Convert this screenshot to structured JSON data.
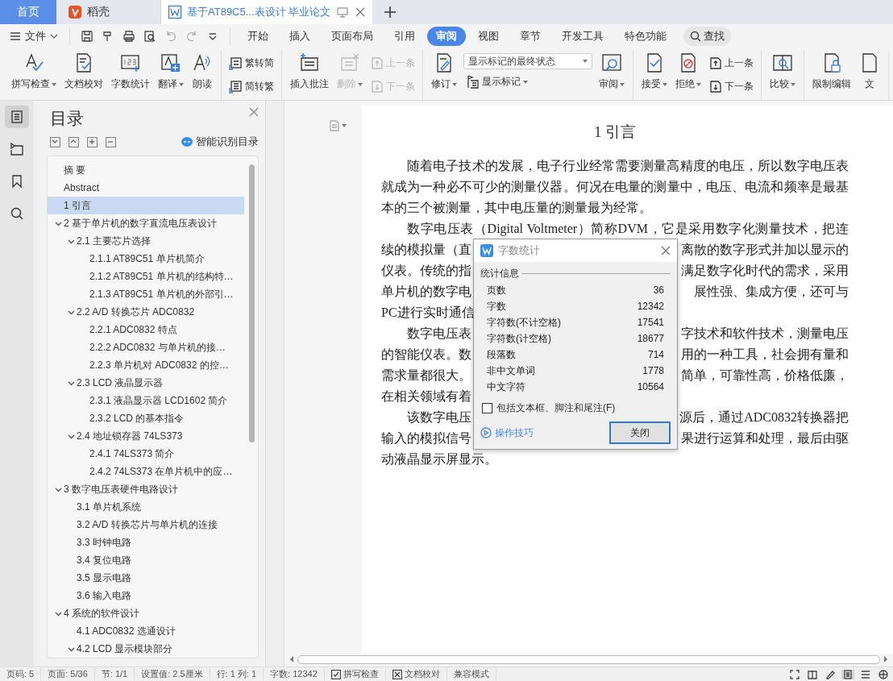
{
  "tabs": [
    {
      "label": "首页",
      "kind": "home",
      "selected": false
    },
    {
      "label": "稻壳",
      "kind": "app",
      "selected": false
    },
    {
      "label": "基于AT89C5...表设计 毕业论文",
      "kind": "doc",
      "selected": true
    }
  ],
  "menu": {
    "file": "文件",
    "tabs": [
      {
        "label": "开始",
        "selected": false
      },
      {
        "label": "插入",
        "selected": false
      },
      {
        "label": "页面布局",
        "selected": false
      },
      {
        "label": "引用",
        "selected": false
      },
      {
        "label": "审阅",
        "selected": true
      },
      {
        "label": "视图",
        "selected": false
      },
      {
        "label": "章节",
        "selected": false
      },
      {
        "label": "开发工具",
        "selected": false
      },
      {
        "label": "特色功能",
        "selected": false
      }
    ],
    "search": "查找"
  },
  "ribbon": [
    [
      {
        "kind": "large",
        "label": "拼写检查",
        "dropdown": true,
        "disabled": false
      },
      {
        "kind": "large",
        "label": "文档校对",
        "dropdown": false,
        "disabled": false
      },
      {
        "kind": "large",
        "label": "字数统计",
        "dropdown": false,
        "disabled": false
      },
      {
        "kind": "large",
        "label": "翻译",
        "dropdown": true,
        "disabled": false
      },
      {
        "kind": "large",
        "label": "朗读",
        "dropdown": false,
        "disabled": false
      }
    ],
    [
      {
        "kind": "stack",
        "items": [
          {
            "label": "繁转简",
            "dropdown": false,
            "disabled": false
          },
          {
            "label": "简转繁",
            "dropdown": false,
            "disabled": false
          }
        ]
      }
    ],
    [
      {
        "kind": "large",
        "label": "插入批注",
        "dropdown": false,
        "disabled": false
      },
      {
        "kind": "large",
        "label": "删除",
        "dropdown": true,
        "disabled": true
      },
      {
        "kind": "stack",
        "items": [
          {
            "label": "上一条",
            "dropdown": false,
            "disabled": true
          },
          {
            "label": "下一条",
            "dropdown": false,
            "disabled": true
          }
        ]
      }
    ],
    [
      {
        "kind": "large",
        "label": "修订",
        "dropdown": true,
        "disabled": false
      },
      {
        "kind": "select",
        "value": "显示标记的最终状态",
        "item": {
          "label": "显示标记",
          "dropdown": true,
          "disabled": false
        }
      },
      {
        "kind": "large",
        "label": "审阅",
        "dropdown": true,
        "disabled": false
      }
    ],
    [
      {
        "kind": "large",
        "label": "接受",
        "dropdown": true,
        "disabled": false
      },
      {
        "kind": "large",
        "label": "拒绝",
        "dropdown": true,
        "disabled": false
      },
      {
        "kind": "stack",
        "items": [
          {
            "label": "上一条",
            "dropdown": false,
            "disabled": false
          },
          {
            "label": "下一条",
            "dropdown": false,
            "disabled": false
          }
        ]
      }
    ],
    [
      {
        "kind": "large",
        "label": "比较",
        "dropdown": true,
        "disabled": false
      }
    ],
    [
      {
        "kind": "large",
        "label": "限制编辑",
        "dropdown": false,
        "disabled": false
      },
      {
        "kind": "large",
        "label": "文",
        "dropdown": false,
        "disabled": false
      }
    ]
  ],
  "sidebar": {
    "title": "目录",
    "smart": "智能识别目录",
    "toc": [
      {
        "label": "摘 要",
        "selected": false
      },
      {
        "label": "Abstract",
        "selected": false
      },
      {
        "label": "1  引言",
        "selected": true
      },
      {
        "label": "2  基于单片机的数字直流电压表设计",
        "selected": false,
        "expanded": true,
        "children": [
          {
            "label": "2.1  主要芯片选择",
            "selected": false,
            "expanded": true,
            "children": [
              {
                "label": "2.1.1 AT89C51 单片机简介",
                "selected": false
              },
              {
                "label": "2.1.2 AT89C51 单片机的结构特…",
                "selected": false
              },
              {
                "label": "2.1.3 AT89C51 单片机的外部引…",
                "selected": false
              }
            ]
          },
          {
            "label": "2.2 A/D 转换芯片 ADC0832",
            "selected": false,
            "expanded": true,
            "children": [
              {
                "label": "2.2.1 ADC0832 特点",
                "selected": false
              },
              {
                "label": "2.2.2 ADC0832  与单片机的接…",
                "selected": false
              },
              {
                "label": "2.2.3  单片机对 ADC0832  的控…",
                "selected": false
              }
            ]
          },
          {
            "label": "2.3 LCD 液晶显示器",
            "selected": false,
            "expanded": true,
            "children": [
              {
                "label": "2.3.1 液晶显示器 LCD1602 简介",
                "selected": false
              },
              {
                "label": "2.3.2 LCD 的基本指令",
                "selected": false
              }
            ]
          },
          {
            "label": "2.4  地址锁存器 74LS373",
            "selected": false,
            "expanded": true,
            "children": [
              {
                "label": "2.4.1 74LS373 简介",
                "selected": false
              },
              {
                "label": "2.4.2 74LS373 在单片机中的应…",
                "selected": false
              }
            ]
          }
        ]
      },
      {
        "label": "3 数字电压表硬件电路设计",
        "selected": false,
        "expanded": true,
        "children": [
          {
            "label": "3.1  单片机系统",
            "selected": false
          },
          {
            "label": "3.2 A/D 转换芯片与单片机的连接",
            "selected": false
          },
          {
            "label": "3.3  时钟电路",
            "selected": false
          },
          {
            "label": "3.4  复位电路",
            "selected": false
          },
          {
            "label": "3.5  显示电路",
            "selected": false
          },
          {
            "label": "3.6  输入电路",
            "selected": false
          }
        ]
      },
      {
        "label": "4 系统的软件设计",
        "selected": false,
        "expanded": true,
        "children": [
          {
            "label": "4.1 ADC0832 选通设计",
            "selected": false
          },
          {
            "label": "4.2 LCD 显示模块部分",
            "selected": false,
            "expanded": true
          }
        ]
      }
    ]
  },
  "document": {
    "heading": "1  引言",
    "lines": [
      {
        "text": "随着电子技术的发展，电子行业经常需要测量高精度的电压，所以数字电压表",
        "indent": true
      },
      {
        "text": "就成为一种必不可少的测量仪器。何况在电量的测量中，电压、电流和频率是最基",
        "indent": false
      },
      {
        "text": "本的三个被测量，其中电压量的测量最为经常。",
        "indent": false,
        "last": true
      },
      {
        "text": "数字电压表（Digital Voltmeter）简称DVM，它是采用数字化测量技术，把连",
        "indent": true
      },
      {
        "left": "续的模拟量（直",
        "right": "离散的数字形式并加以显示的"
      },
      {
        "left": "仪表。传统的指",
        "right": "满足数字化时代的需求，采用"
      },
      {
        "left": "单片机的数字电",
        "right": "展性强、集成方便，还可与"
      },
      {
        "left": "PC进行实时通信"
      },
      {
        "left": "数字电压表",
        "right": "字技术和软件技术，测量电压",
        "indent": true
      },
      {
        "left": "的智能仪表。数",
        "right": "用的一种工具，社会拥有量和"
      },
      {
        "left": "需求量都很大。",
        "right": "简单，可靠性高，价格低廉，"
      },
      {
        "left": "在相关领域有着"
      },
      {
        "left": "该数字电压",
        "right": "源后，通过ADC0832转换器把",
        "indent": true
      },
      {
        "left": "输入的模拟信号",
        "right": "果进行运算和处理，最后由驱"
      },
      {
        "text": "动液晶显示屏显示。",
        "indent": false,
        "last": true
      }
    ]
  },
  "dialog": {
    "title": "字数统计",
    "section": "统计信息",
    "stats": [
      {
        "label": "页数",
        "value": "36"
      },
      {
        "label": "字数",
        "value": "12342"
      },
      {
        "label": "字符数(不计空格)",
        "value": "17541"
      },
      {
        "label": "字符数(计空格)",
        "value": "18677"
      },
      {
        "label": "段落数",
        "value": "714"
      },
      {
        "label": "非中文单词",
        "value": "1778"
      },
      {
        "label": "中文字符",
        "value": "10564"
      }
    ],
    "checkbox": {
      "label": "包括文本框、脚注和尾注(F)",
      "checked": false
    },
    "tips": "操作技巧",
    "button": "关闭"
  },
  "status_bar": {
    "items": [
      "页码: 5",
      "页面: 5/36",
      "节: 1/1",
      "设置值: 2.5厘米",
      "行: 1  列: 1",
      "字数: 12342"
    ],
    "checks": [
      {
        "label": "拼写检查",
        "kind": "check"
      },
      {
        "label": "文档校对",
        "kind": "cross"
      }
    ],
    "mode": "兼容模式",
    "views": [
      {
        "selected": false
      },
      {
        "selected": false
      },
      {
        "selected": false
      },
      {
        "selected": true
      },
      {
        "selected": false
      },
      {
        "selected": false
      }
    ]
  }
}
